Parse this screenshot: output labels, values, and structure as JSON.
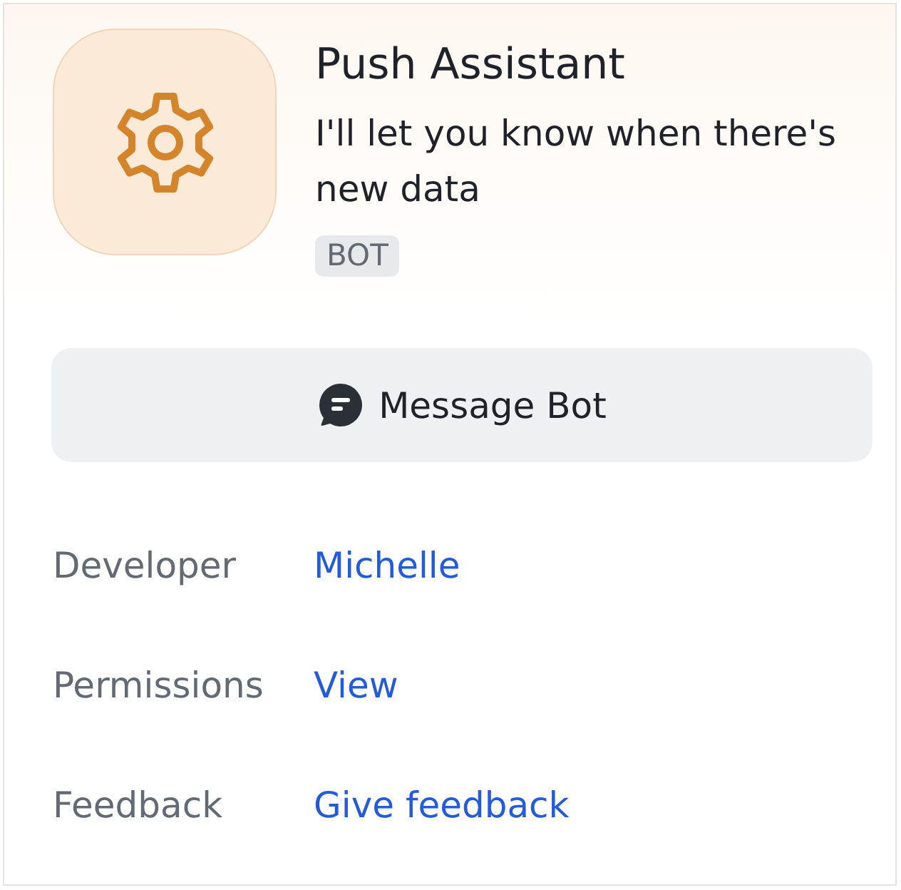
{
  "bot": {
    "name": "Push Assistant",
    "description": "I'll let you know when there's new data",
    "badge": "BOT"
  },
  "message_button": {
    "label": "Message Bot"
  },
  "details": [
    {
      "label": "Developer",
      "value": "Michelle"
    },
    {
      "label": "Permissions",
      "value": "View"
    },
    {
      "label": "Feedback",
      "value": "Give feedback"
    }
  ]
}
